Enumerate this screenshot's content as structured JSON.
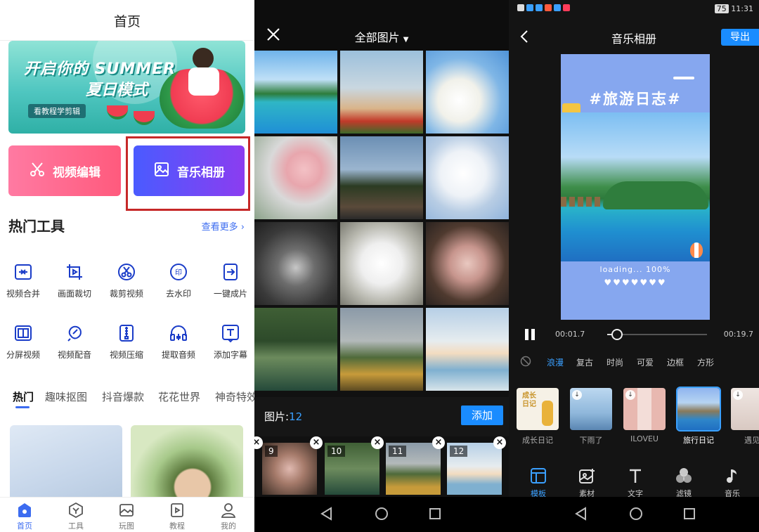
{
  "home": {
    "title": "首页",
    "banner": {
      "line1": "开启你的 SUMMER",
      "line2": "夏日模式",
      "tag": "看教程学剪辑"
    },
    "tiles": {
      "video_edit": "视频编辑",
      "music_album": "音乐相册"
    },
    "hot_tools": {
      "title": "热门工具",
      "more": "查看更多"
    },
    "tools": [
      {
        "label": "视频合并",
        "icon": "merge-icon"
      },
      {
        "label": "画面裁切",
        "icon": "crop-icon"
      },
      {
        "label": "裁剪视频",
        "icon": "scissors-icon"
      },
      {
        "label": "去水印",
        "icon": "watermark-icon"
      },
      {
        "label": "一键成片",
        "icon": "oneclick-icon"
      },
      {
        "label": "分屏视频",
        "icon": "split-screen-icon"
      },
      {
        "label": "视频配音",
        "icon": "dubbing-icon"
      },
      {
        "label": "视频压缩",
        "icon": "compress-icon"
      },
      {
        "label": "提取音频",
        "icon": "headphone-icon"
      },
      {
        "label": "添加字幕",
        "icon": "subtitle-icon"
      }
    ],
    "category_tabs": [
      "热门",
      "趣味抠图",
      "抖音爆款",
      "花花世界",
      "神奇特效"
    ],
    "bottom_nav": [
      "首页",
      "工具",
      "玩图",
      "教程",
      "我的"
    ],
    "colors": {
      "accent": "#3c6cf0",
      "highlight": "#c62828"
    }
  },
  "picker": {
    "title": "全部图片",
    "count_label": "图片:",
    "count": "12",
    "add_button": "添加",
    "selected": [
      "9",
      "10",
      "11",
      "12"
    ]
  },
  "editor": {
    "status_time": "11:31",
    "battery": "75",
    "title": "音乐相册",
    "export": "导出",
    "preview": {
      "title": "#旅游日志#",
      "loading": "loading... 100%",
      "hearts": "♥♥♥♥♥♥♥"
    },
    "time_current": "00:01.7",
    "time_total": "00:19.7",
    "progress": 0.1,
    "categories": [
      "浪漫",
      "复古",
      "时尚",
      "可爱",
      "边框",
      "方形"
    ],
    "templates": [
      "成长日记",
      "下雨了",
      "ILOVEU",
      "旅行日记",
      "遇见"
    ],
    "template_art_1": "成长日记",
    "tools": [
      "模板",
      "素材",
      "文字",
      "滤镜",
      "音乐"
    ],
    "colors": {
      "accent": "#1a8cff"
    }
  }
}
